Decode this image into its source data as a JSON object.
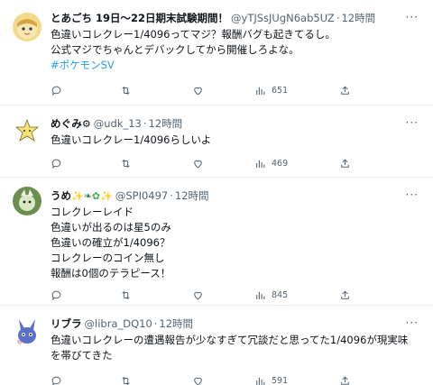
{
  "tweets": [
    {
      "name": "とあごち 19日〜22日期末試験期間！",
      "handle": "@yTJSsJUgN6ab5UZ",
      "separator": "·",
      "time": "12時間",
      "more": "···",
      "lines": [
        "色違いコレクレー1/4096ってマジ？報酬バグも起きてるし。",
        "公式マジでちゃんとデバックしてから開催しろよな。"
      ],
      "hashtag": "#ポケモンSV",
      "views": "651"
    },
    {
      "name": "めぐみ",
      "handle": "@udk_13",
      "separator": "·",
      "time": "12時間",
      "more": "···",
      "lines": [
        "色違いコレクレー1/4096らしいよ"
      ],
      "views": "469"
    },
    {
      "name": "うめ",
      "handle": "@SPI0497",
      "separator": "·",
      "time": "12時間",
      "more": "···",
      "lines": [
        "コレクレーレイド",
        "色違いが出るのは星5のみ",
        "色違いの確立が1/4096？",
        "コレクレーのコイン無し",
        "報酬は0個のテラピース！"
      ],
      "views": "845"
    },
    {
      "name": "リブラ",
      "handle": "@libra_DQ10",
      "separator": "·",
      "time": "12時間",
      "more": "···",
      "lines": [
        "色違いコレクレーの遭遇報告が少なすぎて冗談だと思ってた1/4096が現実味",
        "を帯びてきた"
      ],
      "views": "591"
    }
  ],
  "icons": {
    "reply": "reply-icon",
    "retweet": "retweet-icon",
    "like": "like-icon",
    "views": "views-icon",
    "share": "share-icon"
  },
  "colors": {
    "text": "#0f1419",
    "secondary": "#536471",
    "link": "#1d9bf0",
    "divider": "#e6ebef"
  }
}
